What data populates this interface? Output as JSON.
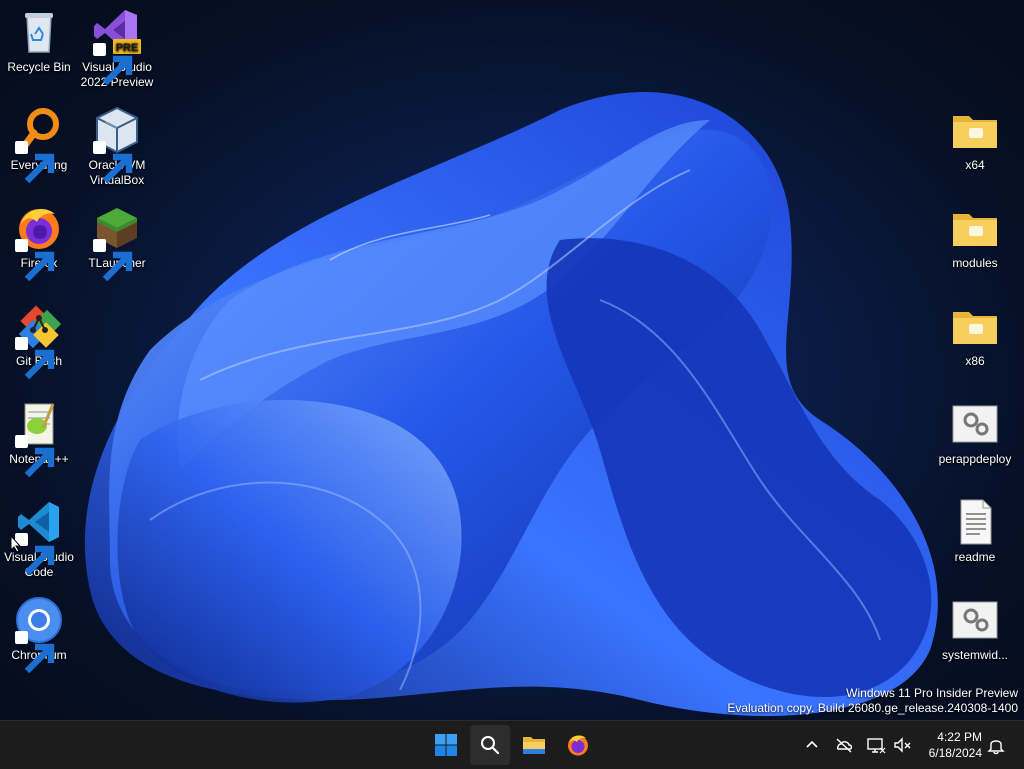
{
  "desktop": {
    "left_icons": [
      {
        "label": "Recycle Bin",
        "icon": "recycle-bin-icon"
      },
      {
        "label": "Visual Studio 2022 Preview",
        "icon": "visual-studio-icon",
        "badge": "PRE"
      },
      {
        "label": "Everything",
        "icon": "everything-search-icon"
      },
      {
        "label": "Oracle VM VirtualBox",
        "icon": "virtualbox-icon"
      },
      {
        "label": "Firefox",
        "icon": "firefox-icon"
      },
      {
        "label": "TLauncher",
        "icon": "tlauncher-icon"
      },
      {
        "label": "Git Bash",
        "icon": "git-bash-icon"
      },
      {
        "label": "Notepad++",
        "icon": "notepad-plus-plus-icon"
      },
      {
        "label": "Visual Studio Code",
        "icon": "vscode-icon"
      },
      {
        "label": "Chromium",
        "icon": "chromium-icon"
      }
    ],
    "right_icons": [
      {
        "label": "x64",
        "icon": "folder-icon"
      },
      {
        "label": "modules",
        "icon": "folder-icon"
      },
      {
        "label": "x86",
        "icon": "folder-icon"
      },
      {
        "label": "perappdeploy",
        "icon": "settings-file-icon"
      },
      {
        "label": "readme",
        "icon": "text-file-icon"
      },
      {
        "label": "systemwid...",
        "icon": "settings-file-icon"
      }
    ]
  },
  "watermark": {
    "line1": "Windows 11 Pro Insider Preview",
    "line2": "Evaluation copy. Build 26080.ge_release.240308-1400"
  },
  "taskbar": {
    "pinned": [
      "start-icon",
      "search-icon",
      "file-explorer-icon",
      "firefox-icon"
    ],
    "tray": [
      "chevron-up-icon",
      "onedrive-offline-icon",
      "network-icon",
      "speaker-muted-icon",
      "notification-bell-icon"
    ],
    "clock": {
      "time": "4:22 PM",
      "date": "6/18/2024"
    }
  },
  "colors": {
    "wallpaper_dark": "#050c1c",
    "wallpaper_blue": "#1f4fe0",
    "taskbar": "#1c1c1c",
    "folder": "#f3c74f"
  }
}
